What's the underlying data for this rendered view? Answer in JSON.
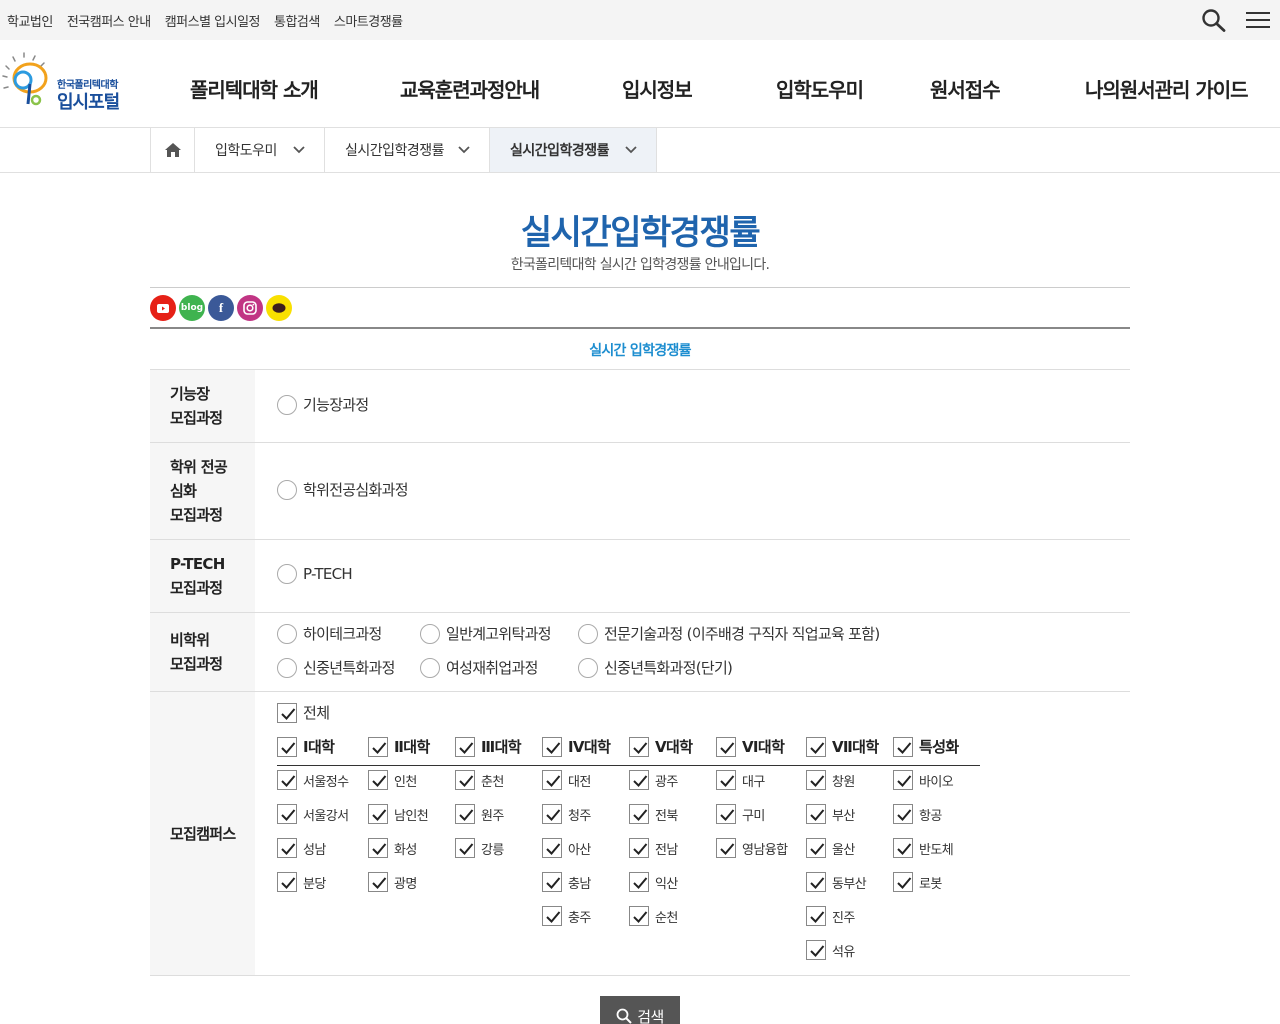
{
  "topbar": {
    "links": [
      "학교법인",
      "전국캠퍼스 안내",
      "캠퍼스별 입시일정",
      "통합검색",
      "스마트경쟁률"
    ]
  },
  "logo": {
    "sub": "한국폴리텍대학",
    "main": "입시포털"
  },
  "gnb": [
    "폴리텍대학 소개",
    "교육훈련과정안내",
    "입시정보",
    "입학도우미",
    "원서접수",
    "나의원서관리 가이드"
  ],
  "breadcrumb": [
    "입학도우미",
    "실시간입학경쟁률",
    "실시간입학경쟁률"
  ],
  "page": {
    "title": "실시간입학경쟁률",
    "desc": "한국폴리텍대학 실시간 입학경쟁률 안내입니다.",
    "caption": "실시간 입학경쟁률"
  },
  "sns": [
    "youtube-icon",
    "blog",
    "facebook-icon",
    "instagram-icon",
    "kakaostory-icon"
  ],
  "sns_labels": {
    "blog": "blog"
  },
  "colors": {
    "accent": "#1f64ad",
    "caption": "#1e8ed0",
    "youtube": "#e62117",
    "blog": "#3fb34f",
    "facebook": "#3b5998",
    "instagram": "#c13584",
    "kakao": "#f9e000"
  },
  "form": {
    "rows": [
      {
        "label": "기능장\n모집과정",
        "options": [
          "기능장과정"
        ]
      },
      {
        "label": "학위 전공\n심화\n모집과정",
        "options": [
          "학위전공심화과정"
        ]
      },
      {
        "label": "P-TECH\n모집과정",
        "options": [
          "P-TECH"
        ]
      },
      {
        "label": "비학위\n모집과정",
        "options": [
          "하이테크과정",
          "일반계고위탁과정",
          "전문기술과정 (이주배경 구직자 직업교육 포함)",
          "신중년특화과정",
          "여성재취업과정",
          "신중년특화과정(단기)"
        ]
      }
    ],
    "campus_label": "모집캠퍼스",
    "all_label": "전체",
    "groups": [
      {
        "name": "Ⅰ대학",
        "campuses": [
          "서울정수",
          "서울강서",
          "성남",
          "분당"
        ]
      },
      {
        "name": "Ⅱ대학",
        "campuses": [
          "인천",
          "남인천",
          "화성",
          "광명"
        ]
      },
      {
        "name": "Ⅲ대학",
        "campuses": [
          "춘천",
          "원주",
          "강릉"
        ]
      },
      {
        "name": "Ⅳ대학",
        "campuses": [
          "대전",
          "청주",
          "아산",
          "충남",
          "충주"
        ]
      },
      {
        "name": "Ⅴ대학",
        "campuses": [
          "광주",
          "전북",
          "전남",
          "익산",
          "순천"
        ]
      },
      {
        "name": "Ⅵ대학",
        "campuses": [
          "대구",
          "구미",
          "영남융합"
        ]
      },
      {
        "name": "Ⅶ대학",
        "campuses": [
          "창원",
          "부산",
          "울산",
          "동부산",
          "진주",
          "석유"
        ]
      },
      {
        "name": "특성화",
        "campuses": [
          "바이오",
          "항공",
          "반도체",
          "로봇"
        ]
      }
    ]
  },
  "search_button": "검색"
}
